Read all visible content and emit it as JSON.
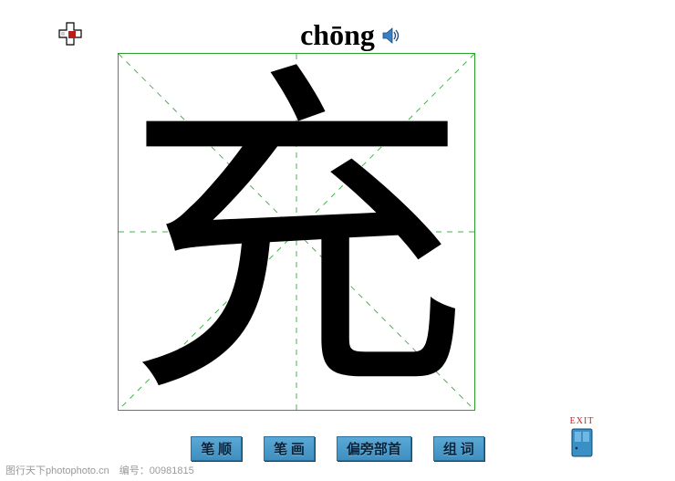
{
  "header": {
    "pinyin": "chōng",
    "home_icon": "home-cross-icon",
    "speaker_icon": "speaker-icon"
  },
  "character": {
    "glyph": "充"
  },
  "buttons": {
    "stroke_order": "笔 顺",
    "strokes": "笔 画",
    "radical": "偏旁部首",
    "words": "组 词"
  },
  "exit": {
    "label": "EXIT",
    "icon": "door-icon"
  },
  "watermark": {
    "site": "图行天下photophoto.cn",
    "id_label": "编号：",
    "id_value": "00981815"
  }
}
